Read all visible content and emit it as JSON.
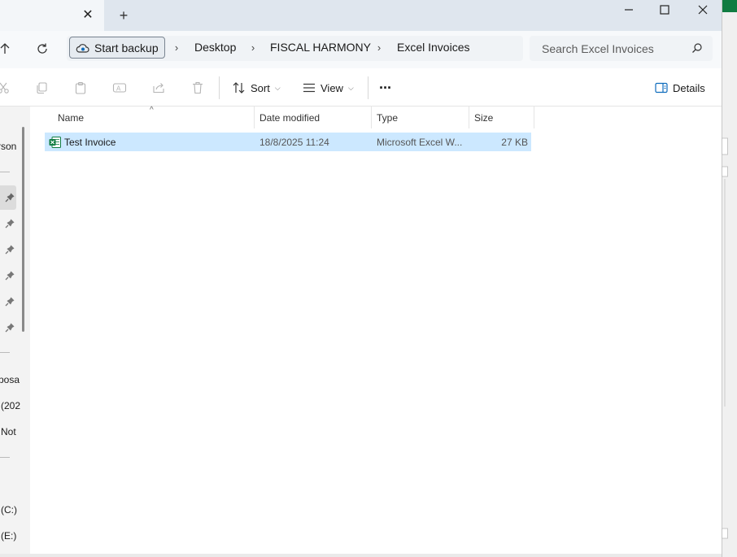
{
  "window": {
    "tab_close_icon": "close-icon",
    "new_tab_icon": "plus-icon",
    "controls": [
      "minimize-icon",
      "maximize-icon",
      "close-icon"
    ]
  },
  "address": {
    "backup_label": "Start backup",
    "breadcrumbs": [
      "Desktop",
      "FISCAL HARMONY",
      "Excel Invoices"
    ],
    "search_placeholder": "Search Excel Invoices"
  },
  "toolbar": {
    "sort_label": "Sort",
    "view_label": "View",
    "more_label": "···",
    "details_label": "Details"
  },
  "nav": {
    "items": [
      "rson",
      "posa",
      "(202",
      "Not",
      "(C:)",
      "(E:)"
    ]
  },
  "columns": [
    "Name",
    "Date modified",
    "Type",
    "Size"
  ],
  "files": [
    {
      "name": "Test Invoice",
      "date_modified": "18/8/2025 11:24",
      "type": "Microsoft Excel W...",
      "size": "27 KB",
      "icon": "excel-file-icon"
    }
  ],
  "colors": {
    "selection": "#cce8ff",
    "excel_green": "#107c41",
    "titlebar": "#dfe6ee"
  }
}
